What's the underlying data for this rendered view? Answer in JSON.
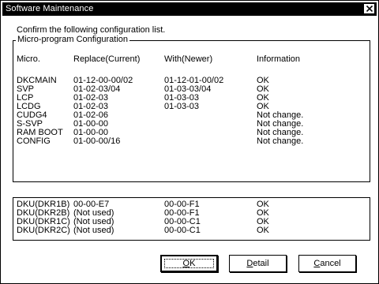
{
  "window": {
    "title": "Software Maintenance"
  },
  "instruction": "Confirm the following configuration list.",
  "group_label": "Micro-program Configuration",
  "columns": {
    "micro": "Micro.",
    "replace": "Replace(Current)",
    "with": "With(Newer)",
    "info": "Information"
  },
  "micro_rows": [
    {
      "micro": "DKCMAIN",
      "replace": "01-12-00-00/02",
      "with": "01-12-01-00/02",
      "info": "OK"
    },
    {
      "micro": "SVP",
      "replace": "01-02-03/04",
      "with": "01-03-03/04",
      "info": "OK"
    },
    {
      "micro": "LCP",
      "replace": "01-02-03",
      "with": "01-03-03",
      "info": "OK"
    },
    {
      "micro": "LCDG",
      "replace": "01-02-03",
      "with": "01-03-03",
      "info": "OK"
    },
    {
      "micro": "CUDG4",
      "replace": "01-02-06",
      "with": "",
      "info": "Not change."
    },
    {
      "micro": "S-SVP",
      "replace": "01-00-00",
      "with": "",
      "info": "Not change."
    },
    {
      "micro": "RAM BOOT",
      "replace": "01-00-00",
      "with": "",
      "info": "Not change."
    },
    {
      "micro": "CONFIG",
      "replace": "01-00-00/16",
      "with": "",
      "info": "Not change."
    }
  ],
  "dku_rows": [
    {
      "name": "DKU(DKR1B)",
      "current": "00-00-E7",
      "newer": "00-00-F1",
      "info": "OK"
    },
    {
      "name": "DKU(DKR2B)",
      "current": "(Not used)",
      "newer": "00-00-F1",
      "info": "OK"
    },
    {
      "name": "DKU(DKR1C)",
      "current": "(Not used)",
      "newer": "00-00-C1",
      "info": "OK"
    },
    {
      "name": "DKU(DKR2C)",
      "current": "(Not used)",
      "newer": "00-00-C1",
      "info": "OK"
    }
  ],
  "buttons": {
    "ok": {
      "mnemonic": "O",
      "rest": "K"
    },
    "detail": {
      "mnemonic": "D",
      "rest": "etail"
    },
    "cancel": {
      "mnemonic": "C",
      "rest": "ancel"
    }
  },
  "icons": {
    "close": "close-icon"
  }
}
